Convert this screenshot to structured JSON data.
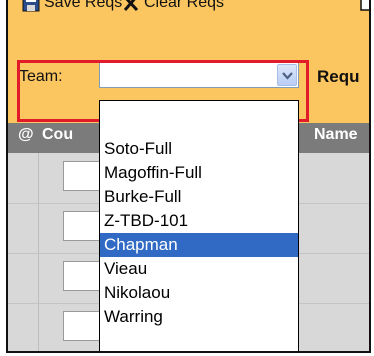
{
  "toolbar": {
    "save_label": "Save Reqs",
    "clear_label": "Clear Reqs"
  },
  "team": {
    "label": "Team:",
    "selected_value": ""
  },
  "requests_label": "Requ",
  "table": {
    "headers": [
      "@",
      "Cou",
      "Name"
    ]
  },
  "dropdown": {
    "options": [
      "",
      "Soto-Full",
      "Magoffin-Full",
      "Burke-Full",
      "Z-TBD-101",
      "Chapman",
      "Vieau",
      "Nikolaou",
      "Warring"
    ],
    "highlighted": "Chapman"
  },
  "colors": {
    "toolbar_bg": "#fbc660",
    "header_bg": "#7b7b7b",
    "highlight_box": "#e21b2a",
    "selection": "#316ac5"
  }
}
